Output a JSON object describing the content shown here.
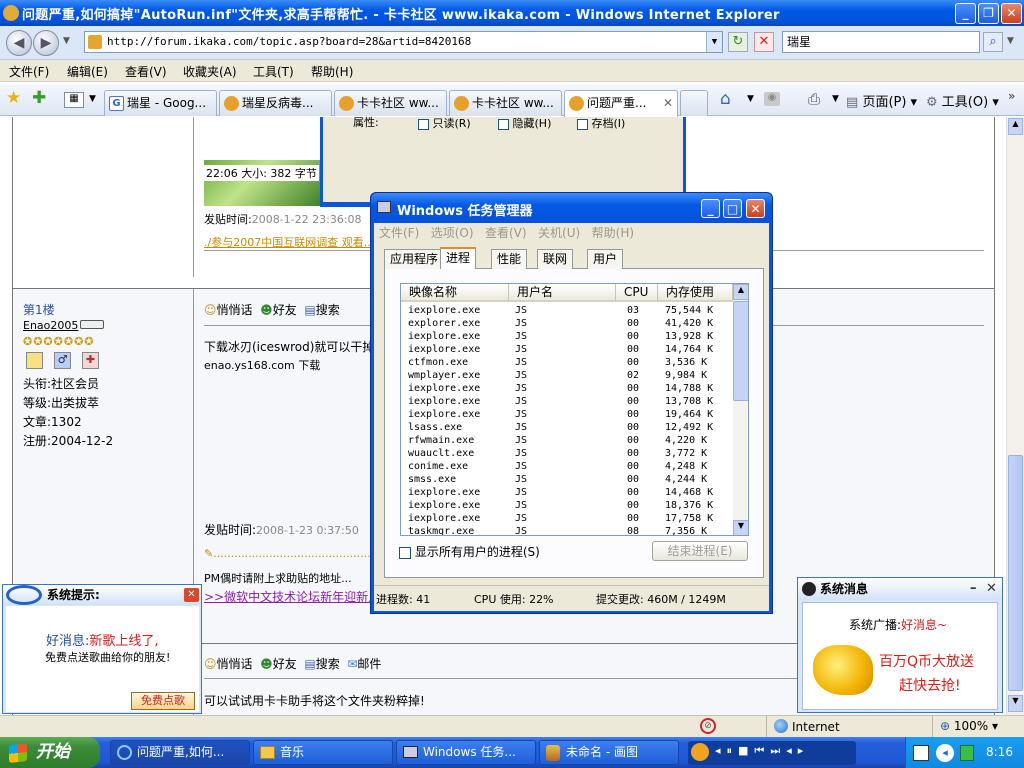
{
  "window": {
    "title": "问题严重,如何搞掉\"AutoRun.inf\"文件夹,求高手帮帮忙. - 卡卡社区 www.ikaka.com - Windows Internet Explorer"
  },
  "address": {
    "url": "http://forum.ikaka.com/topic.asp?board=28&artid=8420168",
    "search_value": "瑞星"
  },
  "menu": [
    "文件(F)",
    "编辑(E)",
    "查看(V)",
    "收藏夹(A)",
    "工具(T)",
    "帮助(H)"
  ],
  "tabs": [
    {
      "label": "瑞星 - Goog..."
    },
    {
      "label": "瑞星反病毒..."
    },
    {
      "label": "卡卡社区 ww..."
    },
    {
      "label": "卡卡社区 ww..."
    },
    {
      "label": "问题严重..."
    }
  ],
  "toolbar": {
    "page_label": "页面(P)",
    "tools_label": "工具(O)"
  },
  "forum": {
    "top_post": {
      "meta": "22:06 大小: 382 字节",
      "time_label": "发贴时间:",
      "time_value": "2008-1-22 23:36:08",
      "survey_link": "./参与2007中国互联网调查 观看..."
    },
    "first_floor": {
      "floor": "第1楼",
      "user": "Enao2005",
      "fields": [
        {
          "label": "头衔:",
          "value": "社区会员"
        },
        {
          "label": "等级:",
          "value": "出类拔萃"
        },
        {
          "label": "文章:",
          "value": "1302"
        },
        {
          "label": "注册:",
          "value": "2004-12-2"
        }
      ],
      "actions": [
        "悄悄话",
        "好友",
        "搜索"
      ],
      "content_line1": "下载冰刃(iceswrod)就可以干掉",
      "content_line2": "enao.ys168.com 下载",
      "time_label": "发贴时间:",
      "time_value": "2008-1-23 0:37:50",
      "sig_line": "PM偶时请附上求助贴的地址...",
      "promo_link": ">>微软中文技术论坛新年迎新人..."
    },
    "bottom_post": {
      "actions": [
        "悄悄话",
        "好友",
        "搜索",
        "邮件"
      ],
      "content": "可以试试用卡卡助手将这个文件夹粉粹掉!"
    }
  },
  "hidden_dialog": {
    "attrs_label": "属性:",
    "checkboxes": [
      "只读(R)",
      "隐藏(H)",
      "存档(I)"
    ]
  },
  "task_manager": {
    "title": "Windows 任务管理器",
    "menu": [
      "文件(F)",
      "选项(O)",
      "查看(V)",
      "关机(U)",
      "帮助(H)"
    ],
    "tabs": [
      "应用程序",
      "进程",
      "性能",
      "联网",
      "用户"
    ],
    "columns": [
      "映像名称",
      "用户名",
      "CPU",
      "内存使用"
    ],
    "processes": [
      [
        "iexplore.exe",
        "JS",
        "03",
        "75,544 K"
      ],
      [
        "explorer.exe",
        "JS",
        "00",
        "41,420 K"
      ],
      [
        "iexplore.exe",
        "JS",
        "00",
        "13,928 K"
      ],
      [
        "iexplore.exe",
        "JS",
        "00",
        "14,764 K"
      ],
      [
        "ctfmon.exe",
        "JS",
        "00",
        "3,536 K"
      ],
      [
        "wmplayer.exe",
        "JS",
        "02",
        "9,984 K"
      ],
      [
        "iexplore.exe",
        "JS",
        "00",
        "14,788 K"
      ],
      [
        "iexplore.exe",
        "JS",
        "00",
        "13,708 K"
      ],
      [
        "iexplore.exe",
        "JS",
        "00",
        "19,464 K"
      ],
      [
        "lsass.exe",
        "JS",
        "00",
        "12,492 K"
      ],
      [
        "rfwmain.exe",
        "JS",
        "00",
        "4,220 K"
      ],
      [
        "wuauclt.exe",
        "JS",
        "00",
        "3,772 K"
      ],
      [
        "conime.exe",
        "JS",
        "00",
        "4,248 K"
      ],
      [
        "smss.exe",
        "JS",
        "00",
        "4,244 K"
      ],
      [
        "iexplore.exe",
        "JS",
        "00",
        "14,468 K"
      ],
      [
        "iexplore.exe",
        "JS",
        "00",
        "18,376 K"
      ],
      [
        "iexplore.exe",
        "JS",
        "00",
        "17,758 K"
      ],
      [
        "taskmgr.exe",
        "JS",
        "08",
        "7,356 K"
      ]
    ],
    "show_all_label": "显示所有用户的进程(S)",
    "end_process_label": "结束进程(E)",
    "status": {
      "processes": "进程数: 41",
      "cpu": "CPU 使用: 22%",
      "commit": "提交更改: 460M / 1249M"
    }
  },
  "popup_left": {
    "title": "系统提示:",
    "line1_prefix": "好消息:",
    "line1_highlight": "新歌上线了,",
    "line2": "免费点送歌曲给你的朋友!",
    "button": "免费点歌"
  },
  "popup_right": {
    "title": "系统消息",
    "broadcast_label": "系统广播:",
    "broadcast_value": "好消息~",
    "promo_line1": "百万Q币大放送",
    "promo_line2": "赶快去抢!"
  },
  "statusbar": {
    "zone": "Internet",
    "zoom": "100%"
  },
  "taskbar": {
    "start": "开始",
    "tasks": [
      "问题严重,如何...",
      "音乐",
      "Windows 任务...",
      "未命名 - 画图"
    ],
    "clock": "8:16"
  },
  "colors": {
    "xp_blue": "#0054dc",
    "start_green": "#3c8c3a",
    "forum_blue": "#2c4ea3",
    "promo_red": "#d71f17"
  }
}
